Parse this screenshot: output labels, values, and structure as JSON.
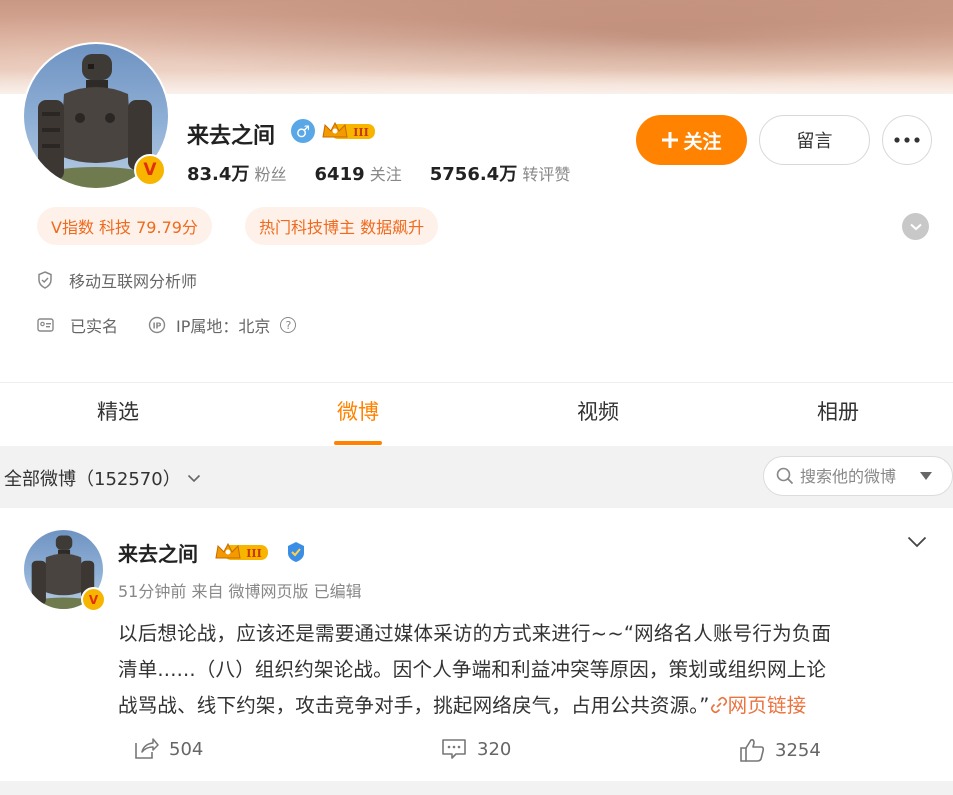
{
  "profile": {
    "name": "来去之间",
    "stats": [
      {
        "value": "83.4万",
        "label": "粉丝"
      },
      {
        "value": "6419",
        "label": "关注"
      },
      {
        "value": "5756.4万",
        "label": "转评赞"
      }
    ],
    "follow_label": "关注",
    "message_label": "留言",
    "vip_level": "III",
    "tags": [
      "V指数 科技 79.79分",
      "热门科技博主 数据飙升"
    ],
    "verified_text": "移动互联网分析师",
    "real_name_text": "已实名",
    "ip_text": "IP属地：北京"
  },
  "tabs": [
    {
      "label": "精选",
      "active": false
    },
    {
      "label": "微博",
      "active": true
    },
    {
      "label": "视频",
      "active": false
    },
    {
      "label": "相册",
      "active": false
    }
  ],
  "filter": {
    "label": "全部微博（152570）",
    "search_placeholder": "搜索他的微博"
  },
  "post": {
    "author": "来去之间",
    "vip_level": "III",
    "meta": "51分钟前 来自 微博网页版 已编辑",
    "text_line1": "以后想论战，应该还是需要通过媒体采访的方式来进行~~“网络名人账号行为负面",
    "text_line2": "清单......（八）组织约架论战。因个人争端和利益冲突等原因，策划或组织网上论",
    "text_line3": "战骂战、线下约架，攻击竞争对手，挑起网络戾气，占用公共资源。”",
    "link_label": "网页链接",
    "reposts": "504",
    "comments": "320",
    "likes": "3254"
  },
  "colors": {
    "accent": "#ff8200",
    "tag_bg": "#fdf1ea",
    "tag_text": "#f06a1d",
    "link": "#eb7340",
    "male_blue": "#5aa7e8"
  }
}
